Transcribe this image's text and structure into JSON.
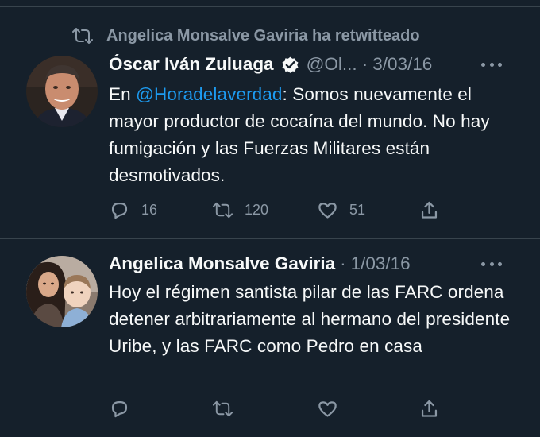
{
  "retweet_context": {
    "text": "Angelica Monsalve Gaviria ha retwitteado"
  },
  "tweets": [
    {
      "author_name": "Óscar Iván Zuluaga",
      "verified": true,
      "handle": "@Ol...",
      "separator": "·",
      "date": "3/03/16",
      "text_mention": "@Horadelaverdad",
      "text_prefix": "En ",
      "text_rest": ": Somos nuevamente el mayor productor de cocaína del mundo. No hay fumigación y las Fuerzas Militares están desmotivados.",
      "replies": "16",
      "retweets": "120",
      "likes": "51"
    },
    {
      "author_name": "Angelica Monsalve Gaviria",
      "separator": "·",
      "date": "1/03/16",
      "text": "Hoy el régimen santista pilar de las FARC ordena detener arbitrariamente al hermano del presidente Uribe, y las FARC como Pedro en casa",
      "replies": "",
      "retweets": "",
      "likes": ""
    }
  ],
  "colors": {
    "background": "#15202b",
    "text_primary": "#f7f9f9",
    "text_secondary": "#8b98a5",
    "accent_link": "#1d9bf0",
    "divider": "#38444d"
  },
  "icons": [
    "retweet-icon",
    "verified-badge-icon",
    "more-icon",
    "reply-icon",
    "like-icon",
    "share-icon"
  ]
}
